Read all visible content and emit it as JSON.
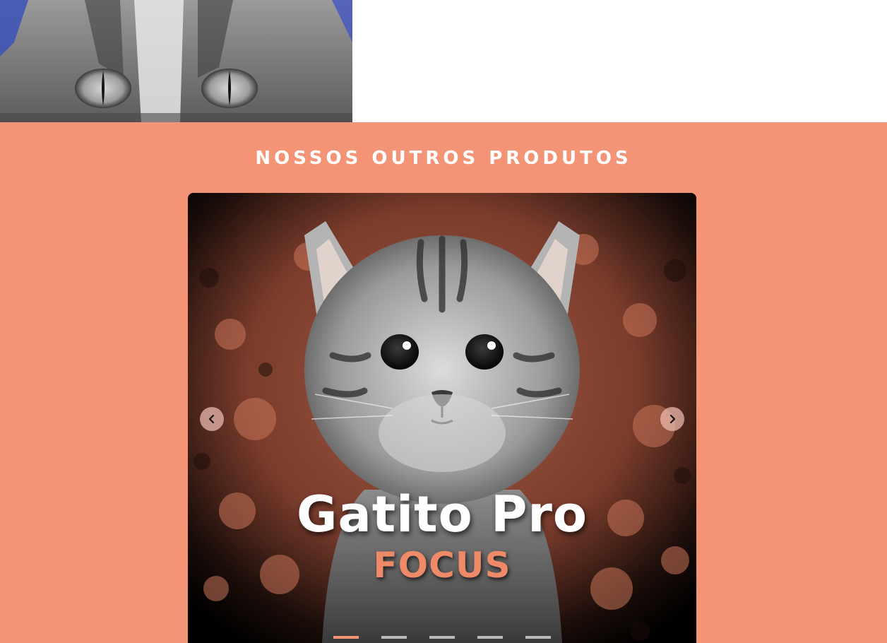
{
  "section": {
    "title": "NOSSOS OUTROS PRODUTOS"
  },
  "carousel": {
    "slide_title": "Gatito Pro",
    "slide_subtitle": "FOCUS",
    "prev_icon": "chevron-left-icon",
    "next_icon": "chevron-right-icon",
    "indicator_count": 5,
    "active_indicator": 1
  },
  "colors": {
    "section_bg": "#f39476",
    "accent": "#ef8a68",
    "indicator_inactive": "#b9b9b9",
    "nav_button": "#eebeb0"
  }
}
